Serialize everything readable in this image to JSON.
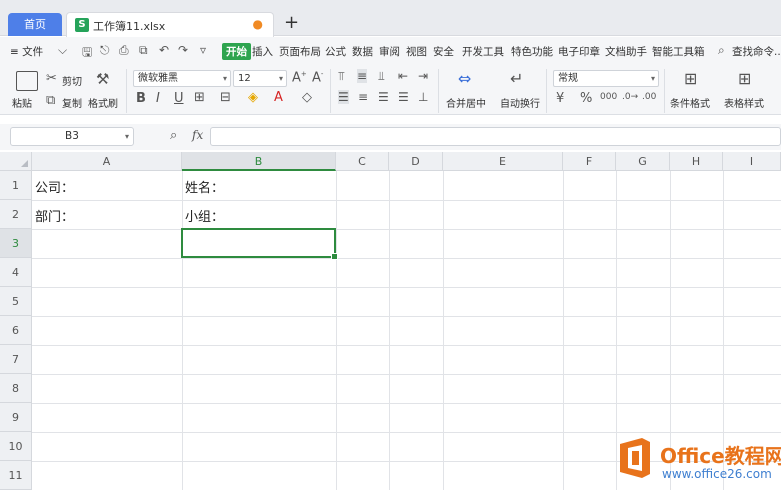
{
  "tabs": {
    "home": "首页",
    "file": "工作簿11.xlsx",
    "add": "+"
  },
  "menu": {
    "file": "≡ 文件",
    "items": [
      "开始",
      "插入",
      "页面布局",
      "公式",
      "数据",
      "审阅",
      "视图",
      "安全",
      "开发工具",
      "特色功能",
      "电子印章",
      "文档助手",
      "智能工具箱"
    ],
    "active": "开始",
    "search": "查找命令..."
  },
  "ribbon": {
    "paste": "粘贴",
    "cut": "剪切",
    "copy": "复制",
    "format_painter": "格式刷",
    "font_name": "微软雅黑",
    "font_size": "12",
    "merge_center": "合并居中",
    "wrap_text": "自动换行",
    "number_format": "常规",
    "conditional_format": "条件格式",
    "table_style": "表格样式"
  },
  "formula_bar": {
    "name_box": "B3",
    "fx": "fx",
    "value": ""
  },
  "sheet": {
    "columns": [
      "A",
      "B",
      "C",
      "D",
      "E",
      "F",
      "G",
      "H",
      "I"
    ],
    "rows": [
      "1",
      "2",
      "3",
      "4",
      "5",
      "6",
      "7",
      "8",
      "9",
      "10",
      "11"
    ],
    "selected_cell": "B3",
    "cells": {
      "A1": "公司：",
      "B1": "姓名：",
      "A2": "部门：",
      "B2": "小组："
    }
  },
  "watermark": {
    "line1": "Office教程网",
    "line2": "www.office26.com"
  },
  "colors": {
    "accent": "#2e8b3f",
    "tab_active": "#4e7fe8",
    "file_icon": "#25a35a"
  }
}
